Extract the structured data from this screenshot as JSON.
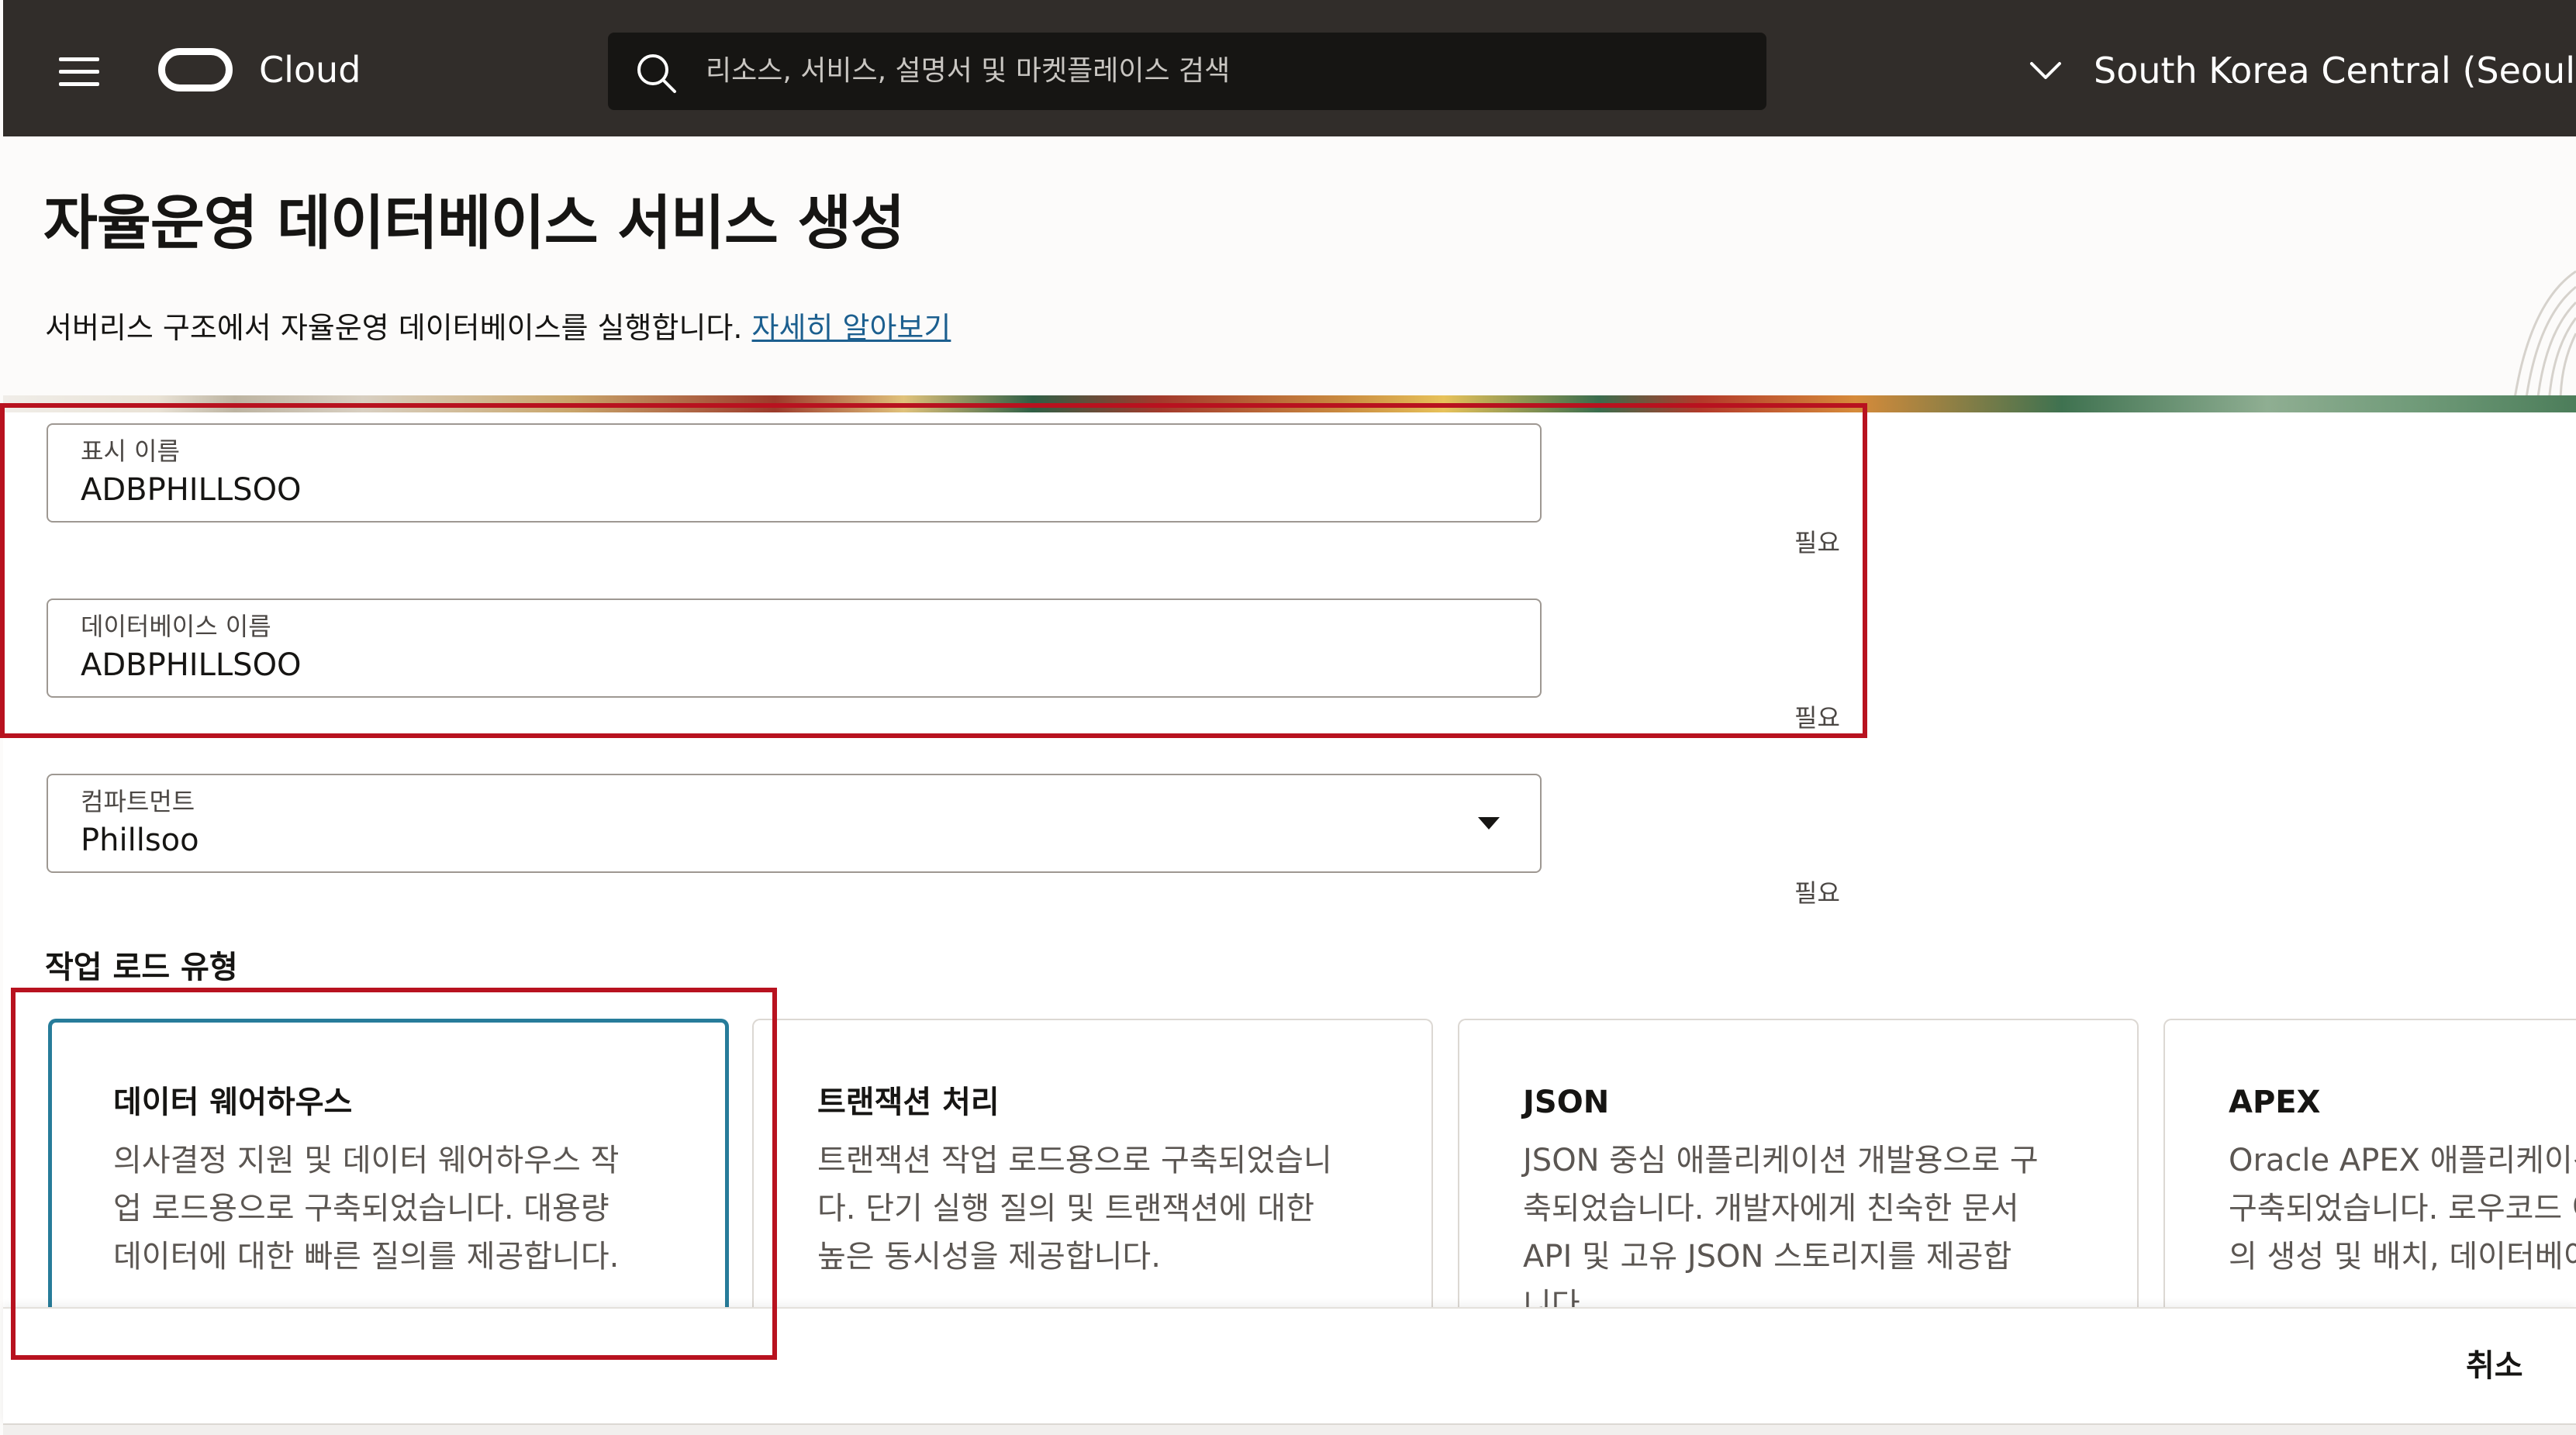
{
  "topbar": {
    "menu_icon": "hamburger-menu-icon",
    "logo_icon": "oracle-logo-icon",
    "brand": "Cloud",
    "search": {
      "icon": "search-icon",
      "placeholder": "리소스, 서비스, 설명서 및 마켓플레이스 검색"
    },
    "region": {
      "icon": "chevron-down-icon",
      "label": "South Korea Central (Seoul)"
    }
  },
  "header": {
    "title": "자율운영 데이터베이스 서비스 생성",
    "description": "서버리스 구조에서 자율운영 데이터베이스를 실행합니다.",
    "learn_more": "자세히 알아보기"
  },
  "form": {
    "display_name": {
      "label": "표시 이름",
      "value": "ADBPHILLSOO",
      "required": "필요"
    },
    "database_name": {
      "label": "데이터베이스 이름",
      "value": "ADBPHILLSOO",
      "required": "필요"
    },
    "compartment": {
      "label": "컴파트먼트",
      "value": "Phillsoo",
      "required": "필요",
      "icon": "caret-down-icon"
    },
    "workload_section": "작업 로드 유형",
    "workload_types": [
      {
        "title": "데이터 웨어하우스",
        "description": "의사결정 지원 및 데이터 웨어하우스 작\n업 로드용으로 구축되었습니다. 대용량\n데이터에 대한 빠른 질의를 제공합니다.",
        "selected": true
      },
      {
        "title": "트랜잭션 처리",
        "description": "트랜잭션 작업 로드용으로 구축되었습니\n다. 단기 실행 질의 및 트랜잭션에 대한\n높은 동시성을 제공합니다.",
        "selected": false
      },
      {
        "title": "JSON",
        "description": "JSON 중심 애플리케이션 개발용으로 구\n축되었습니다. 개발자에게 친숙한 문서\nAPI 및 고유 JSON 스토리지를 제공합\n니다.",
        "selected": false
      },
      {
        "title": "APEX",
        "description": "Oracle APEX 애플리케이션 개발용으로\n구축되었습니다. 로우코드 애플리케이션\n의 생성 및 배치, 데이터베이스 포함.",
        "selected": false
      }
    ]
  },
  "footer": {
    "cancel": "취소"
  },
  "colors": {
    "topbar_bg": "#312d2a",
    "search_bg": "#161513",
    "link": "#1c5f8f",
    "selected_card_border": "#277c9a",
    "annotation_red": "#b8121f"
  }
}
